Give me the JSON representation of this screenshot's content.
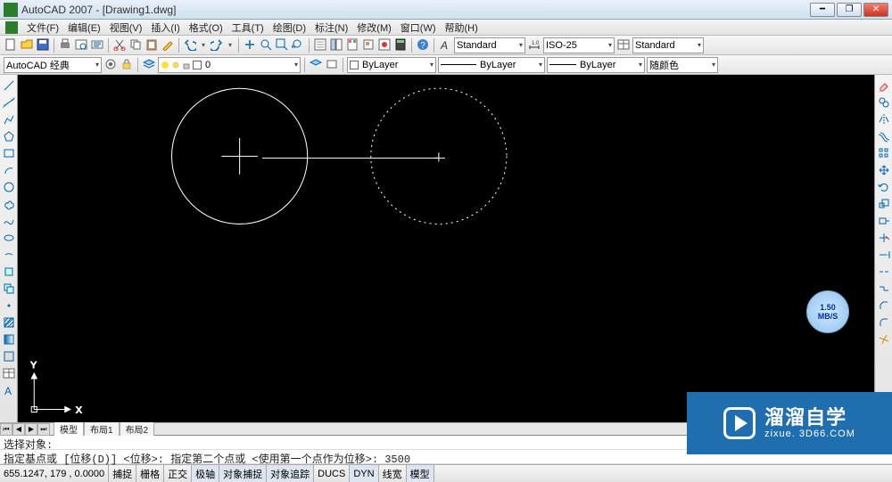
{
  "title": "AutoCAD 2007 - [Drawing1.dwg]",
  "menu": {
    "file": "文件(F)",
    "edit": "编辑(E)",
    "view": "视图(V)",
    "insert": "插入(I)",
    "format": "格式(O)",
    "tools": "工具(T)",
    "draw": "绘图(D)",
    "dim": "标注(N)",
    "modify": "修改(M)",
    "window": "窗口(W)",
    "help": "帮助(H)"
  },
  "styles": {
    "text": "Standard",
    "dim": "ISO-25",
    "table": "Standard"
  },
  "workspace": "AutoCAD 经典",
  "layer_current": "0",
  "linetype_combo": "ByLayer",
  "lineweight_combo": "ByLayer",
  "ltype_sample": "ByLayer",
  "colorcombo": "随颜色",
  "tabs": {
    "model": "模型",
    "layout1": "布局1",
    "layout2": "布局2"
  },
  "cmd": {
    "line1": "选择对象:",
    "line2": "指定基点或 [位移(D)] <位移>:  指定第二个点或 <使用第一个点作为位移>: 3500"
  },
  "coords": "655.1247, 179    , 0.0000",
  "status": {
    "snap": "捕捉",
    "grid": "栅格",
    "ortho": "正交",
    "polar": "极轴",
    "osnap": "对象捕捉",
    "otrack": "对象追踪",
    "ducs": "DUCS",
    "dyn": "DYN",
    "lwt": "线宽",
    "model": "模型"
  },
  "axes": {
    "x": "X",
    "y": "Y"
  },
  "speed": {
    "val": "1.50",
    "unit": "MB/S"
  },
  "wm": {
    "big": "溜溜自学",
    "small": "zixue. 3D66.COM"
  }
}
